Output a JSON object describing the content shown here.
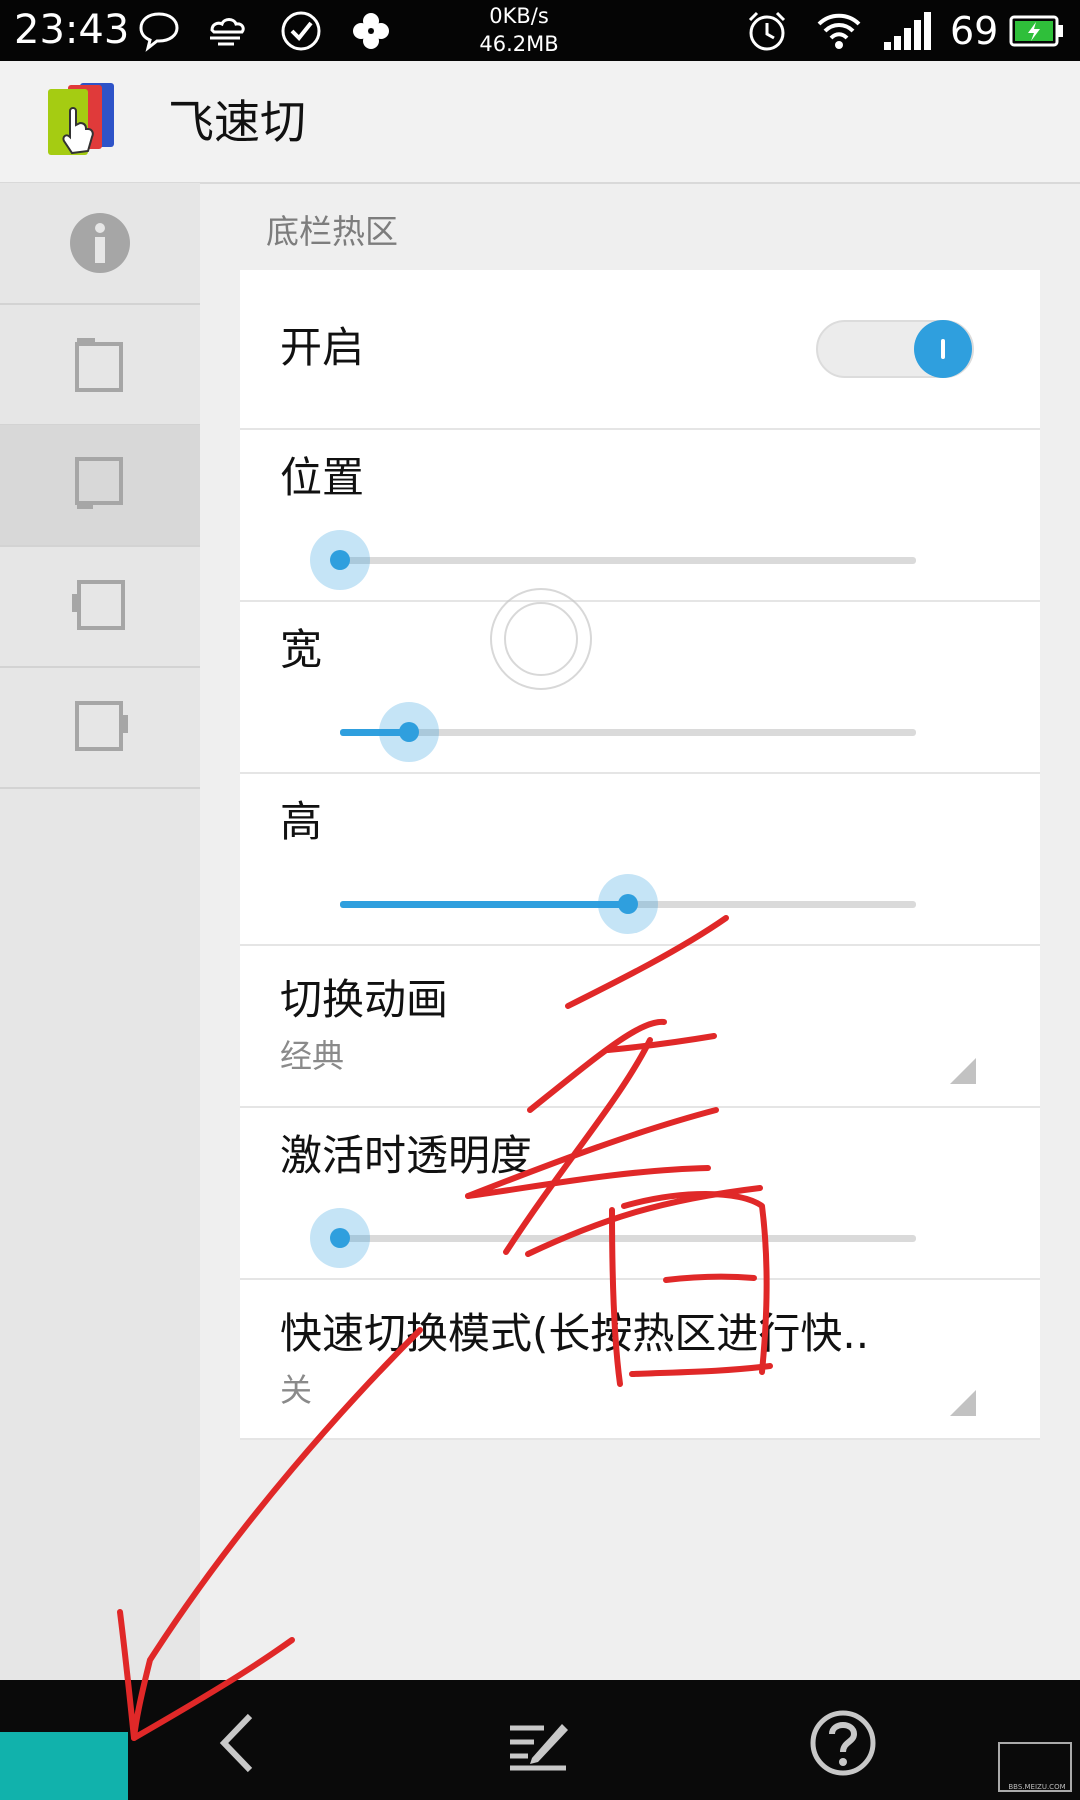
{
  "status_bar": {
    "time": "23:43",
    "net_speed": "0KB/s",
    "net_total": "46.2MB",
    "battery": "69",
    "icons": [
      "chat-icon",
      "cloud-icon",
      "check-circle-icon",
      "clover-icon",
      "alarm-icon",
      "wifi-icon",
      "signal-icon",
      "battery-charging-icon"
    ]
  },
  "app": {
    "title": "飞速切",
    "logo_icon": "app-logo-icon"
  },
  "sidebar": {
    "items": [
      {
        "icon": "info-icon",
        "active": false
      },
      {
        "icon": "hotzone-top-icon",
        "active": false
      },
      {
        "icon": "hotzone-bottom-icon",
        "active": true
      },
      {
        "icon": "hotzone-left-icon",
        "active": false
      },
      {
        "icon": "hotzone-right-icon",
        "active": false
      }
    ]
  },
  "main": {
    "section_title": "底栏热区",
    "enable": {
      "label": "开启",
      "checked": true
    },
    "position": {
      "label": "位置",
      "value_fraction": 0.0
    },
    "width": {
      "label": "宽",
      "value_fraction": 0.12
    },
    "height": {
      "label": "高",
      "value_fraction": 0.5
    },
    "animation": {
      "label": "切换动画",
      "value": "经典"
    },
    "opacity": {
      "label": "激活时透明度",
      "value_fraction": 0.0
    },
    "quick_mode": {
      "label": "快速切换模式(长按热区进行快..",
      "value": "关"
    }
  },
  "annotation": {
    "handwritten_text": "看",
    "color": "#e02828"
  },
  "colors": {
    "accent": "#2f9fde",
    "teal_hotzone": "#11b2ac"
  },
  "nav_bar": {
    "icons": [
      "back-icon",
      "edit-icon",
      "help-icon"
    ]
  },
  "watermark": "BBS.MEIZU.COM"
}
